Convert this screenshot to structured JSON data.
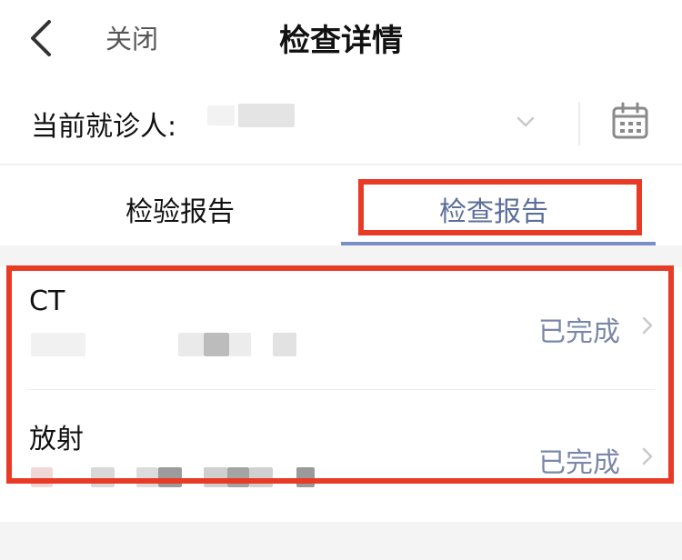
{
  "nav": {
    "close_label": "关闭",
    "title": "检查详情"
  },
  "patient": {
    "label": "当前就诊人:"
  },
  "tabs": [
    {
      "label": "检验报告",
      "active": false
    },
    {
      "label": "检查报告",
      "active": true
    }
  ],
  "reports": [
    {
      "title": "CT",
      "status": "已完成"
    },
    {
      "title": "放射",
      "status": "已完成"
    }
  ],
  "colors": {
    "accent": "#7b8ec4",
    "status": "#7a87a8",
    "highlight": "#e83a24",
    "background_gray": "#f4f4f5"
  },
  "icons": {
    "back": "chevron-left-icon",
    "dropdown": "chevron-down-icon",
    "calendar": "calendar-icon",
    "item_arrow": "chevron-right-icon"
  }
}
